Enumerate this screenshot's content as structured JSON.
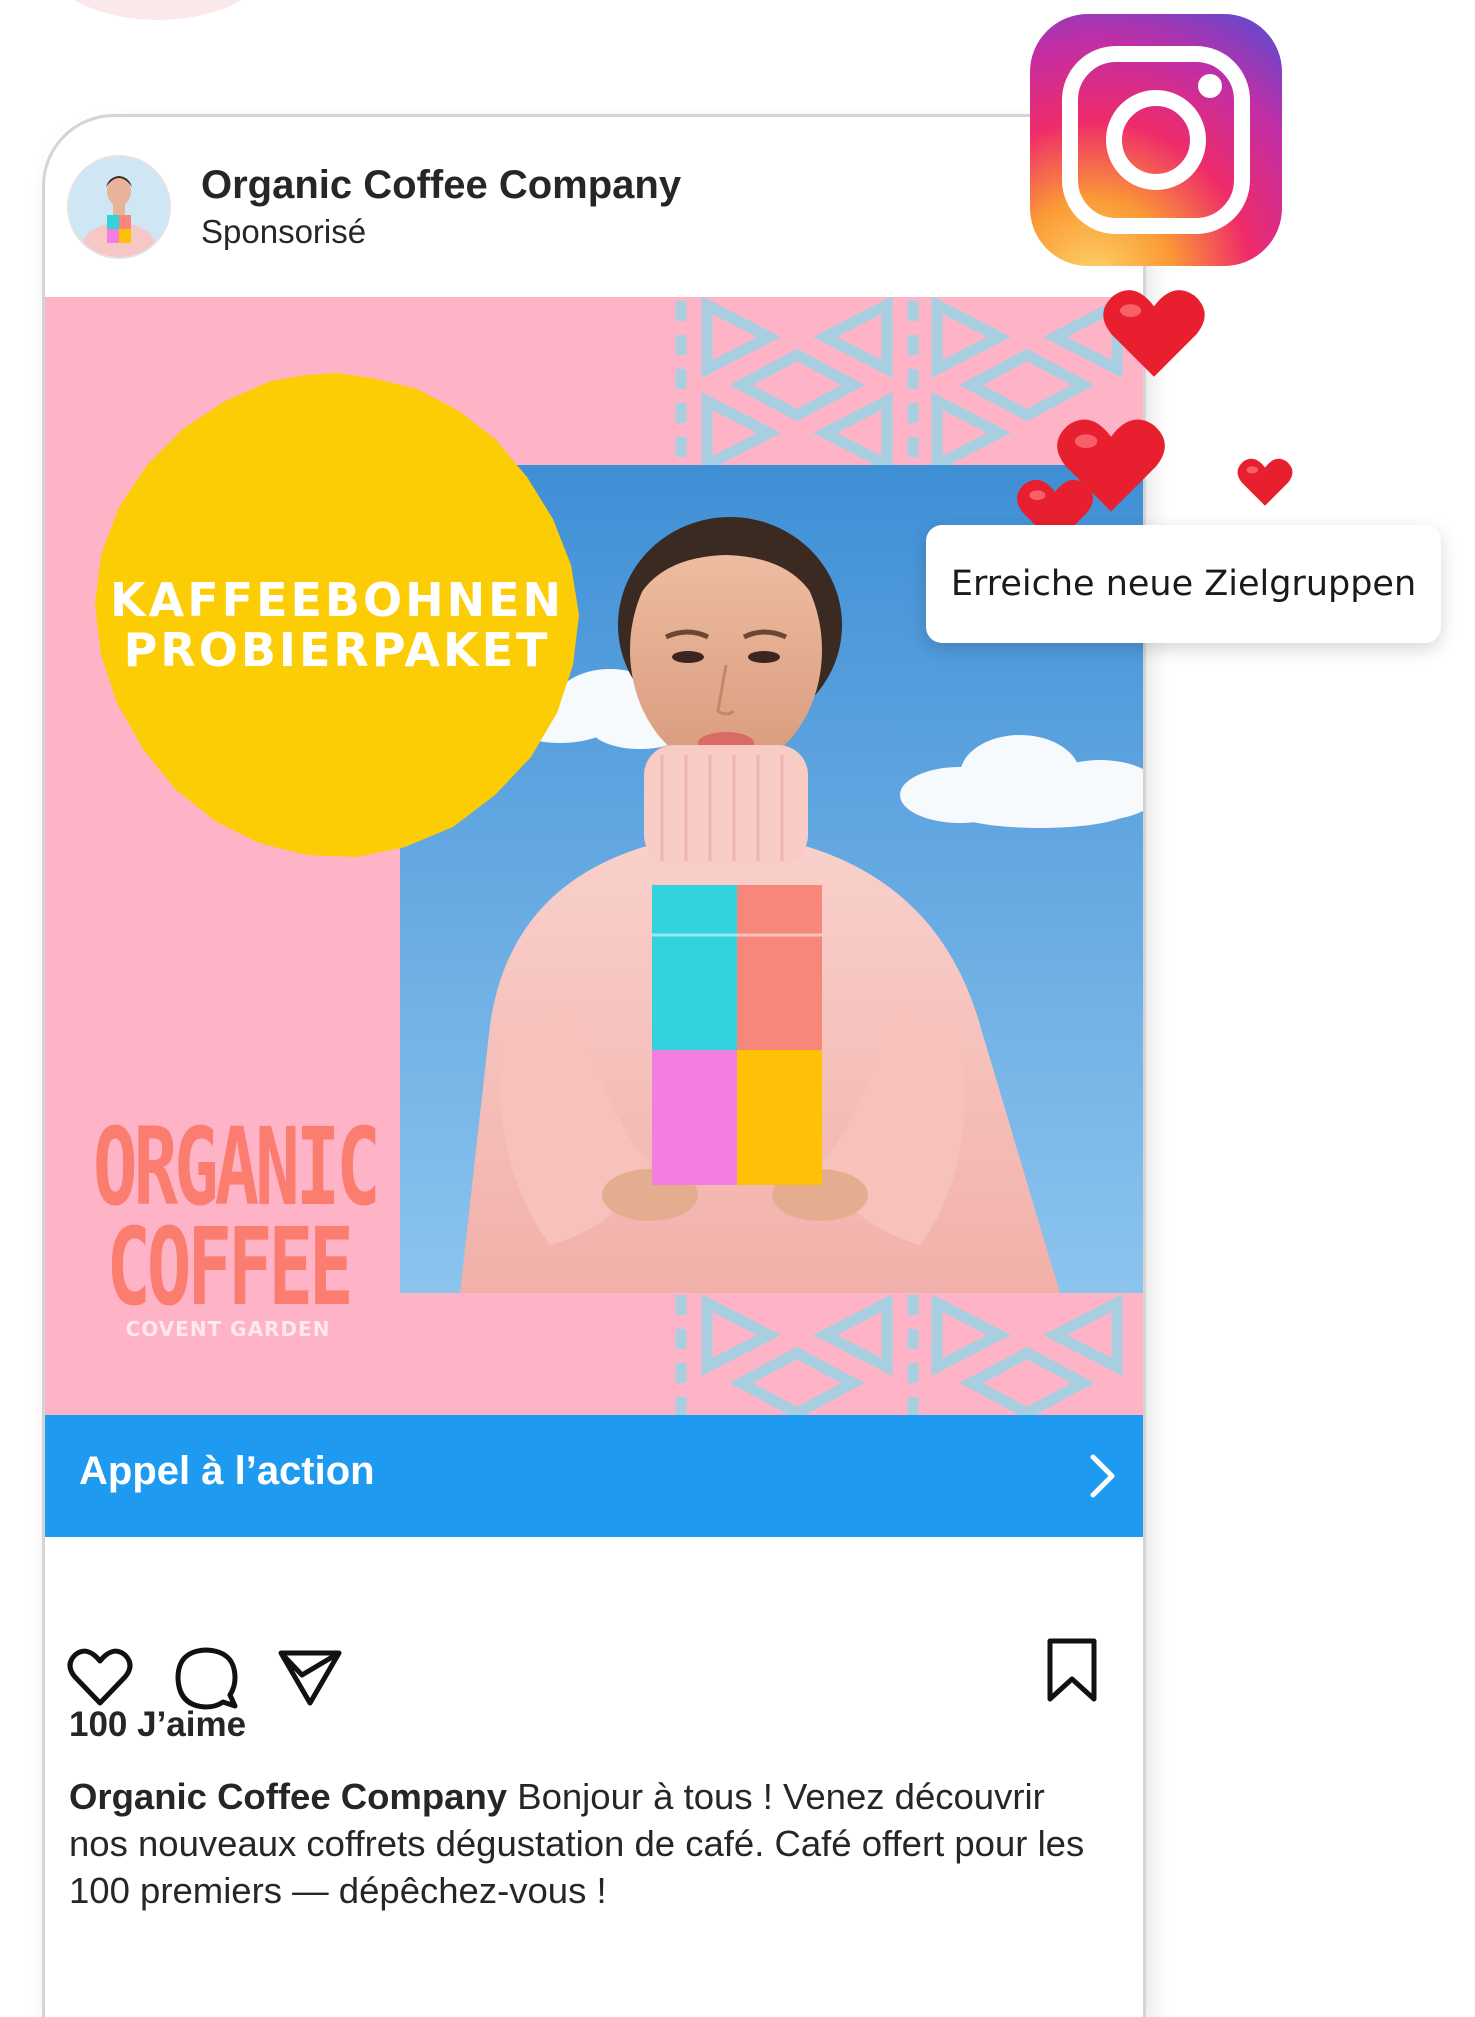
{
  "post": {
    "account_name": "Organic Coffee Company",
    "sponsored_label": "Sponsorisé"
  },
  "ad": {
    "headline_line1": "KAFFEEBOHNEN",
    "headline_line2": "PROBIERPAKET",
    "brand_line1": "ORGANIC",
    "brand_line2": "COFFEE",
    "brand_location": "COVENT GARDEN"
  },
  "cta": {
    "label": "Appel à l’action"
  },
  "engagement": {
    "likes": "100 J’aime"
  },
  "caption": {
    "author": "Organic Coffee Company",
    "text": " Bonjour à tous ! Venez découvrir nos nouveaux coffrets dégustation de café. Café offert pour les 100 premiers — dépêchez-vous !"
  },
  "tooltip": {
    "text": "Erreiche neue Zielgruppen"
  },
  "icons": [
    "instagram-icon",
    "heart-icon",
    "comment-icon",
    "share-icon",
    "bookmark-icon",
    "chevron-right-icon"
  ],
  "colors": {
    "ad_background": "#ffb3c7",
    "sun_yellow": "#fccc05",
    "cta_blue": "#1e9bf0",
    "brand_coral": "#fa7d6f",
    "pattern_blue": "#a7cfe0"
  }
}
